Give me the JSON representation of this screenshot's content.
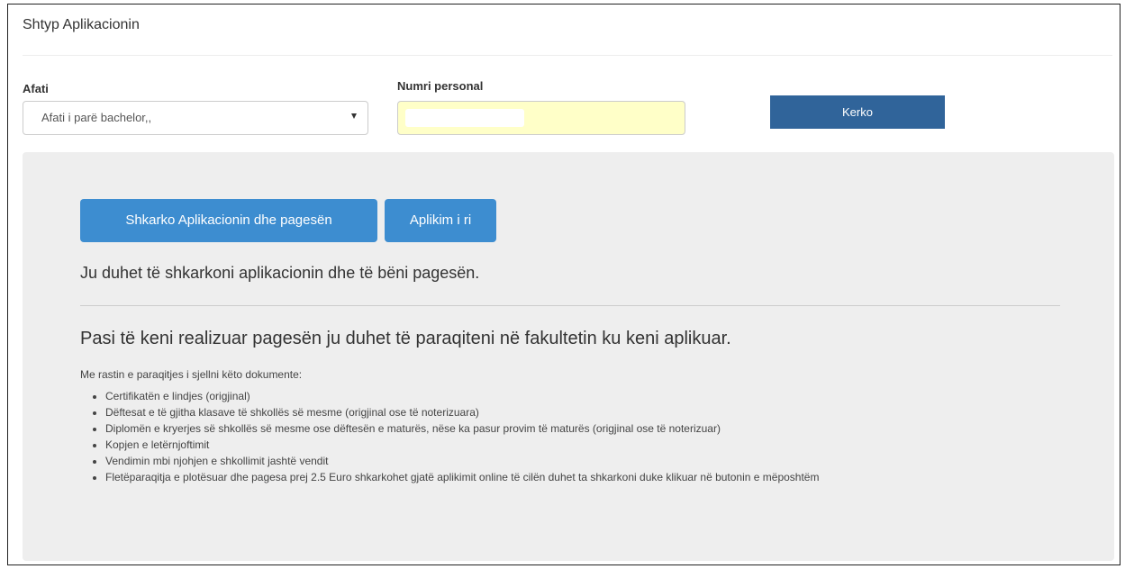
{
  "panel": {
    "title": "Shtyp Aplikacionin"
  },
  "form": {
    "term_label": "Afati",
    "term_selected": "Afati i parë bachelor,,",
    "personal_label": "Numri personal",
    "personal_value": "",
    "search_label": "Kerko"
  },
  "result": {
    "download_button": "Shkarko Aplikacionin dhe pagesën",
    "new_button": "Aplikim i ri",
    "notice": "Ju duhet të shkarkoni aplikacionin dhe të bëni pagesën.",
    "heading": "Pasi të keni realizuar pagesën ju duhet të paraqiteni në fakultetin ku keni aplikuar.",
    "intro": "Me rastin e paraqitjes i sjellni këto dokumente:",
    "documents": [
      "Certifikatën e lindjes (origjinal)",
      "Dëftesat e të gjitha klasave të shkollës së mesme (origjinal ose të noterizuara)",
      "Diplomën e kryerjes së shkollës së mesme ose dëftesën e maturës, nëse ka pasur provim të maturës (origjinal ose të noterizuar)",
      "Kopjen e letërnjoftimit",
      "Vendimin mbi njohjen e shkollimit jashtë vendit",
      "Fletëparaqitja e plotësuar dhe pagesa prej 2.5 Euro shkarkohet gjatë aplikimit online të cilën duhet ta shkarkoni duke klikuar në butonin e mëposhtëm"
    ]
  }
}
